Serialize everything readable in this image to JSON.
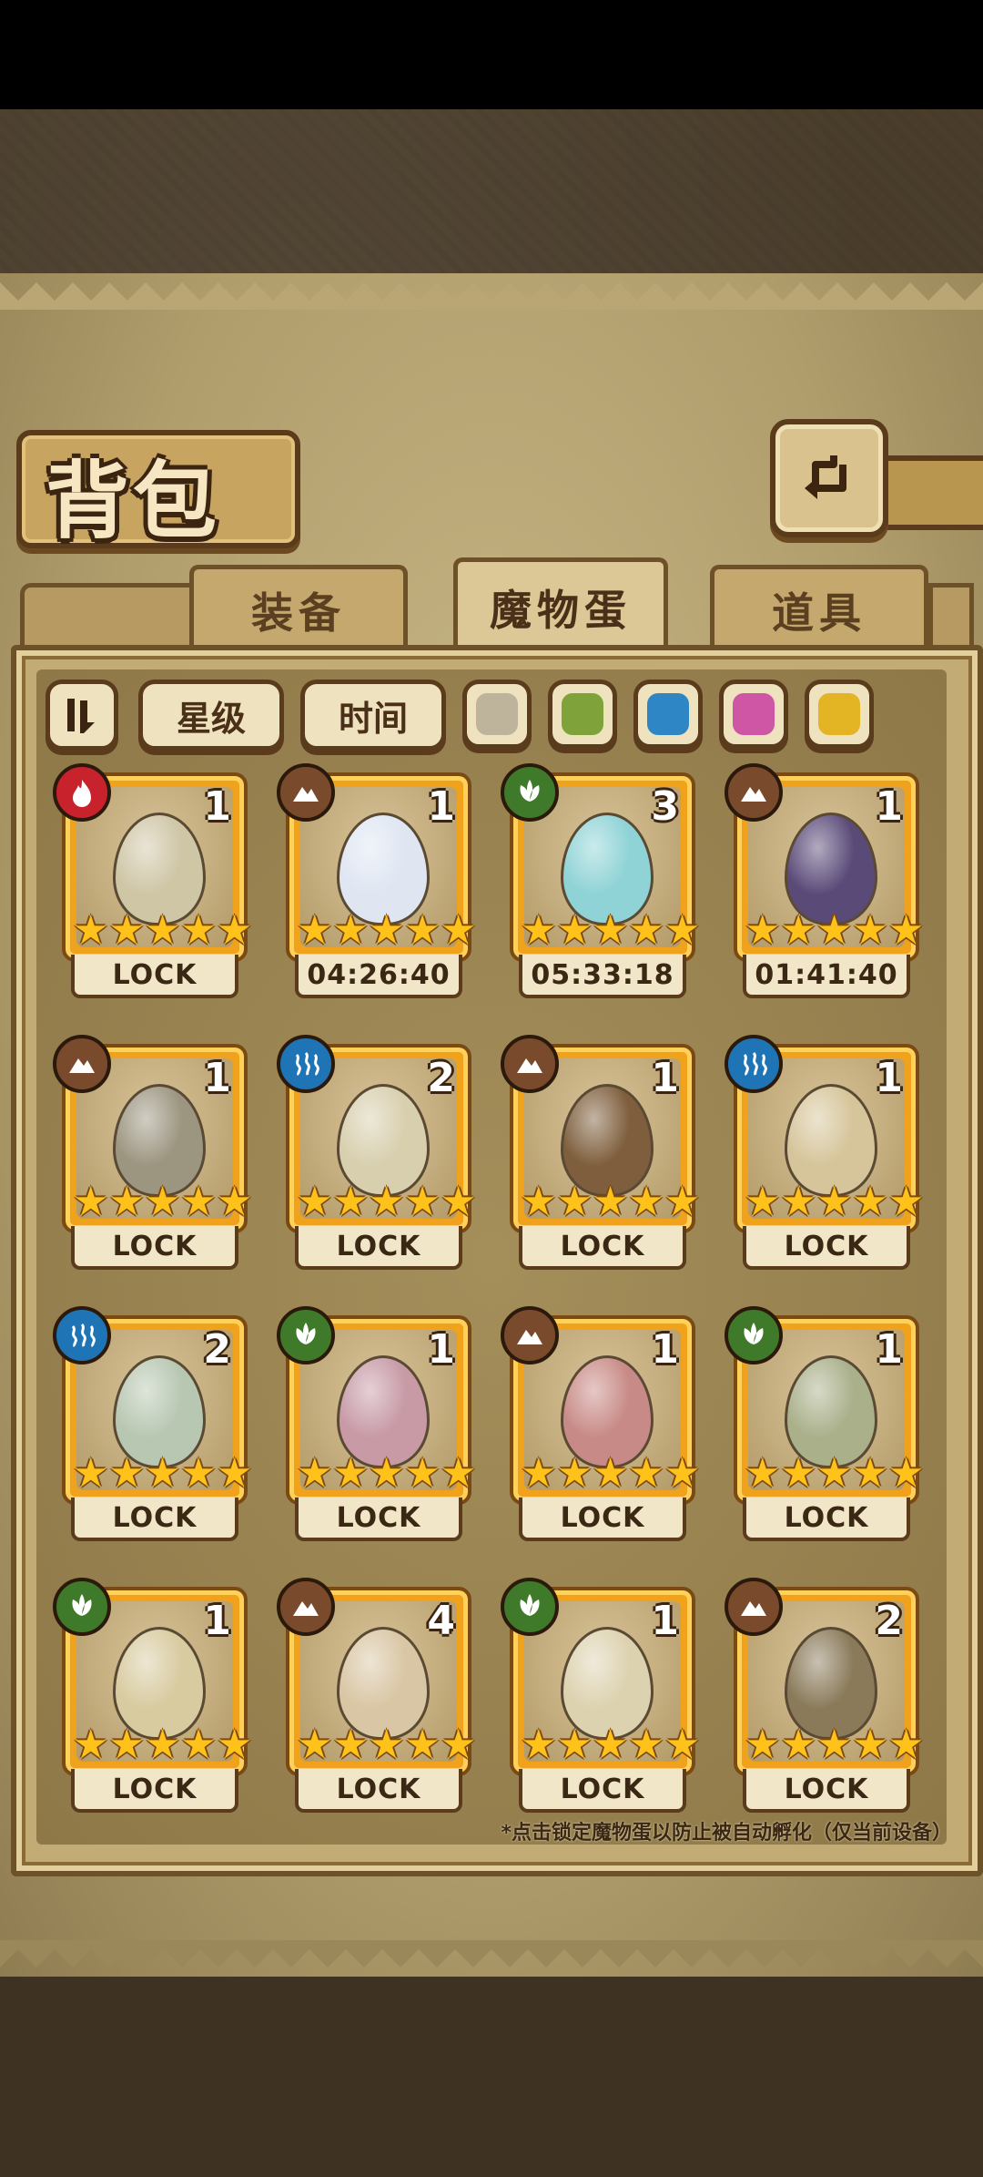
{
  "title": "背包",
  "tabs": [
    {
      "label": "装备",
      "active": false
    },
    {
      "label": "魔物蛋",
      "active": true
    },
    {
      "label": "道具",
      "active": false
    }
  ],
  "filters": {
    "sort_icon": "sort-toggle-icon",
    "star_label": "星级",
    "time_label": "时间",
    "colors": [
      {
        "name": "gray",
        "hex": "#bdb49b"
      },
      {
        "name": "green",
        "hex": "#7fa33a"
      },
      {
        "name": "blue",
        "hex": "#2f86c4"
      },
      {
        "name": "pink",
        "hex": "#cf56a4"
      },
      {
        "name": "yellow",
        "hex": "#e3b424"
      }
    ]
  },
  "element_colors": {
    "fire": "#c8232c",
    "earth": "#7a4a2c",
    "nature": "#3f7a2a",
    "water": "#1f74b6"
  },
  "eggs": [
    {
      "element": "fire",
      "count": "1",
      "status": "LOCK",
      "stars": 5,
      "egg_color": "#cfc6a6"
    },
    {
      "element": "earth",
      "count": "1",
      "status": "04:26:40",
      "stars": 5,
      "egg_color": "#dfe6f2"
    },
    {
      "element": "nature",
      "count": "3",
      "status": "05:33:18",
      "stars": 5,
      "egg_color": "#8fd3d6"
    },
    {
      "element": "earth",
      "count": "1",
      "status": "01:41:40",
      "stars": 5,
      "egg_color": "#5a4a78"
    },
    {
      "element": "earth",
      "count": "1",
      "status": "LOCK",
      "stars": 5,
      "egg_color": "#9c9580"
    },
    {
      "element": "water",
      "count": "2",
      "status": "LOCK",
      "stars": 5,
      "egg_color": "#d8cfae"
    },
    {
      "element": "earth",
      "count": "1",
      "status": "LOCK",
      "stars": 5,
      "egg_color": "#7e5e3c"
    },
    {
      "element": "water",
      "count": "1",
      "status": "LOCK",
      "stars": 5,
      "egg_color": "#d6c59a"
    },
    {
      "element": "water",
      "count": "2",
      "status": "LOCK",
      "stars": 5,
      "egg_color": "#b8c7b2"
    },
    {
      "element": "nature",
      "count": "1",
      "status": "LOCK",
      "stars": 5,
      "egg_color": "#c79aa6"
    },
    {
      "element": "earth",
      "count": "1",
      "status": "LOCK",
      "stars": 5,
      "egg_color": "#c88a86"
    },
    {
      "element": "nature",
      "count": "1",
      "status": "LOCK",
      "stars": 5,
      "egg_color": "#a9b08a"
    },
    {
      "element": "nature",
      "count": "1",
      "status": "LOCK",
      "stars": 5,
      "egg_color": "#d8cba0"
    },
    {
      "element": "earth",
      "count": "4",
      "status": "LOCK",
      "stars": 5,
      "egg_color": "#d9c6a4"
    },
    {
      "element": "nature",
      "count": "1",
      "status": "LOCK",
      "stars": 5,
      "egg_color": "#ddd2b0"
    },
    {
      "element": "earth",
      "count": "2",
      "status": "LOCK",
      "stars": 5,
      "egg_color": "#8a7a5a"
    }
  ],
  "note": "*点击锁定魔物蛋以防止被自动孵化（仅当前设备）"
}
